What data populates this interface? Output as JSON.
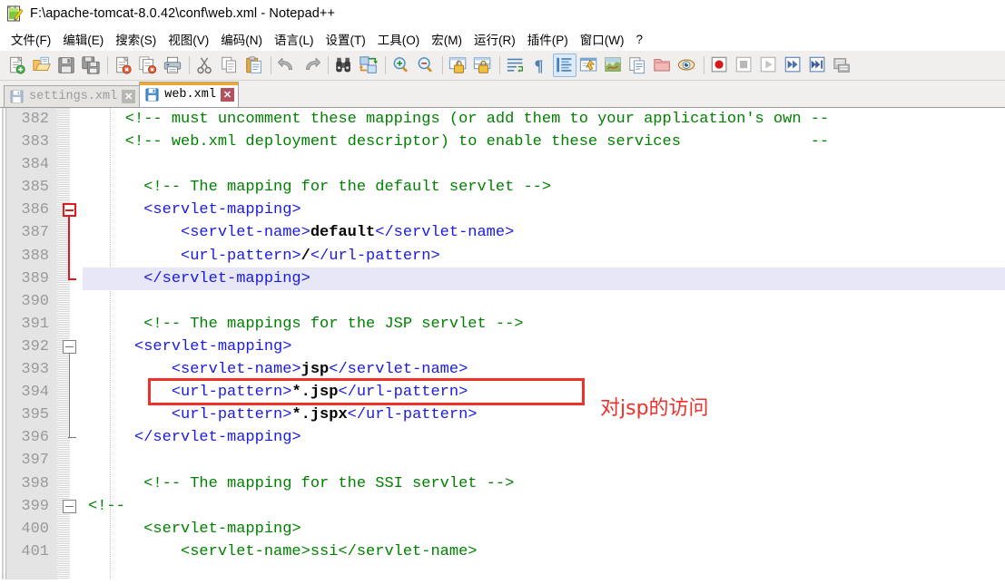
{
  "window": {
    "title": "F:\\apache-tomcat-8.0.42\\conf\\web.xml - Notepad++",
    "app_icon": "notepad-pencil-icon"
  },
  "menubar": {
    "items": [
      {
        "label": "文件(F)",
        "name": "menu-file"
      },
      {
        "label": "编辑(E)",
        "name": "menu-edit"
      },
      {
        "label": "搜索(S)",
        "name": "menu-search"
      },
      {
        "label": "视图(V)",
        "name": "menu-view"
      },
      {
        "label": "编码(N)",
        "name": "menu-encoding"
      },
      {
        "label": "语言(L)",
        "name": "menu-language"
      },
      {
        "label": "设置(T)",
        "name": "menu-settings"
      },
      {
        "label": "工具(O)",
        "name": "menu-tools"
      },
      {
        "label": "宏(M)",
        "name": "menu-macro"
      },
      {
        "label": "运行(R)",
        "name": "menu-run"
      },
      {
        "label": "插件(P)",
        "name": "menu-plugins"
      },
      {
        "label": "窗口(W)",
        "name": "menu-window"
      },
      {
        "label": "?",
        "name": "menu-help"
      }
    ]
  },
  "toolbar": {
    "buttons": [
      {
        "icon": "new-file-icon",
        "active": false
      },
      {
        "icon": "open-folder-icon",
        "active": false
      },
      {
        "icon": "save-icon",
        "active": false
      },
      {
        "icon": "save-all-icon",
        "active": false
      },
      {
        "sep": true
      },
      {
        "icon": "close-file-icon",
        "active": false
      },
      {
        "icon": "close-all-files-icon",
        "active": false
      },
      {
        "icon": "print-icon",
        "active": false
      },
      {
        "sep": true
      },
      {
        "icon": "cut-scissors-icon",
        "active": false
      },
      {
        "icon": "copy-icon",
        "active": false
      },
      {
        "icon": "paste-icon",
        "active": false
      },
      {
        "sep": true
      },
      {
        "icon": "undo-arrow-icon",
        "active": false
      },
      {
        "icon": "redo-arrow-icon",
        "active": false
      },
      {
        "sep": true
      },
      {
        "icon": "find-binoculars-icon",
        "active": false
      },
      {
        "icon": "replace-icon",
        "active": false
      },
      {
        "sep": true
      },
      {
        "icon": "zoom-in-icon",
        "active": false
      },
      {
        "icon": "zoom-out-icon",
        "active": false
      },
      {
        "sep": true
      },
      {
        "icon": "sync-vertical-scroll-icon",
        "active": false
      },
      {
        "icon": "sync-horizontal-scroll-icon",
        "active": false
      },
      {
        "sep": true
      },
      {
        "icon": "word-wrap-icon",
        "active": false
      },
      {
        "icon": "show-all-chars-icon",
        "active": false
      },
      {
        "icon": "indent-guide-icon",
        "active": true
      },
      {
        "icon": "user-defined-dialog-icon",
        "active": false
      },
      {
        "icon": "document-map-icon",
        "active": false
      },
      {
        "icon": "function-list-icon",
        "active": false
      },
      {
        "icon": "folder-workspace-icon",
        "active": false
      },
      {
        "icon": "monitoring-eye-icon",
        "active": false
      },
      {
        "sep": true
      },
      {
        "icon": "macro-record-icon",
        "active": false
      },
      {
        "icon": "macro-stop-icon",
        "active": false
      },
      {
        "icon": "macro-play-icon",
        "active": false
      },
      {
        "icon": "macro-playback-multiple-icon",
        "active": false
      },
      {
        "icon": "macro-run-multiple-icon",
        "active": false
      },
      {
        "icon": "macro-save-icon",
        "active": false
      }
    ]
  },
  "tabs": [
    {
      "label": "settings.xml",
      "active": false,
      "icon": "save-disk-icon",
      "close": "✕"
    },
    {
      "label": "web.xml",
      "active": true,
      "icon": "save-disk-icon",
      "close": "✕"
    }
  ],
  "editor": {
    "first_line_number": 382,
    "lines": [
      {
        "n": 382,
        "current": false,
        "fold": null,
        "tokens": [
          {
            "t": "comment",
            "s": "    <!-- must uncomment these mappings (or add them to your application's own --"
          }
        ]
      },
      {
        "n": 383,
        "current": false,
        "fold": null,
        "tokens": [
          {
            "t": "comment",
            "s": "    <!-- web.xml deployment descriptor) to enable these services              --"
          }
        ]
      },
      {
        "n": 384,
        "current": false,
        "fold": null,
        "tokens": []
      },
      {
        "n": 385,
        "current": false,
        "fold": null,
        "tokens": [
          {
            "t": "comment",
            "s": "      <!-- The mapping for the default servlet -->"
          }
        ]
      },
      {
        "n": 386,
        "current": false,
        "fold": "red-open",
        "tokens": [
          {
            "t": "tag",
            "s": "      <servlet-mapping>"
          }
        ]
      },
      {
        "n": 387,
        "current": false,
        "fold": null,
        "tokens": [
          {
            "t": "tag",
            "s": "          <servlet-name>"
          },
          {
            "t": "text",
            "s": "default"
          },
          {
            "t": "tag",
            "s": "</servlet-name>"
          }
        ]
      },
      {
        "n": 388,
        "current": false,
        "fold": null,
        "tokens": [
          {
            "t": "tag",
            "s": "          <url-pattern>"
          },
          {
            "t": "text",
            "s": "/"
          },
          {
            "t": "tag",
            "s": "</url-pattern>"
          }
        ]
      },
      {
        "n": 389,
        "current": true,
        "fold": "red-close",
        "tokens": [
          {
            "t": "tag",
            "s": "      </servlet-mapping>"
          }
        ]
      },
      {
        "n": 390,
        "current": false,
        "fold": null,
        "tokens": []
      },
      {
        "n": 391,
        "current": false,
        "fold": null,
        "tokens": [
          {
            "t": "comment",
            "s": "      <!-- The mappings for the JSP servlet -->"
          }
        ]
      },
      {
        "n": 392,
        "current": false,
        "fold": "grey-open",
        "tokens": [
          {
            "t": "tag",
            "s": "     <servlet-mapping>"
          }
        ]
      },
      {
        "n": 393,
        "current": false,
        "fold": null,
        "tokens": [
          {
            "t": "tag",
            "s": "         <servlet-name>"
          },
          {
            "t": "text",
            "s": "jsp"
          },
          {
            "t": "tag",
            "s": "</servlet-name>"
          }
        ]
      },
      {
        "n": 394,
        "current": false,
        "fold": null,
        "annotated": true,
        "tokens": [
          {
            "t": "tag",
            "s": "         <url-pattern>"
          },
          {
            "t": "text",
            "s": "*.jsp"
          },
          {
            "t": "tag",
            "s": "</url-pattern>"
          }
        ]
      },
      {
        "n": 395,
        "current": false,
        "fold": null,
        "tokens": [
          {
            "t": "tag",
            "s": "         <url-pattern>"
          },
          {
            "t": "text",
            "s": "*.jspx"
          },
          {
            "t": "tag",
            "s": "</url-pattern>"
          }
        ]
      },
      {
        "n": 396,
        "current": false,
        "fold": "grey-close",
        "tokens": [
          {
            "t": "tag",
            "s": "     </servlet-mapping>"
          }
        ]
      },
      {
        "n": 397,
        "current": false,
        "fold": null,
        "tokens": []
      },
      {
        "n": 398,
        "current": false,
        "fold": null,
        "tokens": [
          {
            "t": "comment",
            "s": "      <!-- The mapping for the SSI servlet -->"
          }
        ]
      },
      {
        "n": 399,
        "current": false,
        "fold": "grey-open2",
        "tokens": [
          {
            "t": "comment",
            "s": "<!--"
          }
        ]
      },
      {
        "n": 400,
        "current": false,
        "fold": null,
        "tokens": [
          {
            "t": "comment",
            "s": "      <servlet-mapping>"
          }
        ]
      },
      {
        "n": 401,
        "current": false,
        "fold": null,
        "tokens": [
          {
            "t": "comment",
            "s": "          <servlet-name>ssi</servlet-name>"
          }
        ]
      }
    ]
  },
  "annotation": {
    "text": "对jsp的访问",
    "color": "#f0302a",
    "box_color": "#f0302a"
  },
  "colors": {
    "comment": "#008000",
    "tag": "#1a1ae6",
    "text": "#000000",
    "current_line": "#e7e7f7",
    "gutter_bg": "#e4e4e4",
    "line_number": "#9a9a9a",
    "tab_active_accent": "#f5a623",
    "toolbar_bg": "#f0efee"
  }
}
